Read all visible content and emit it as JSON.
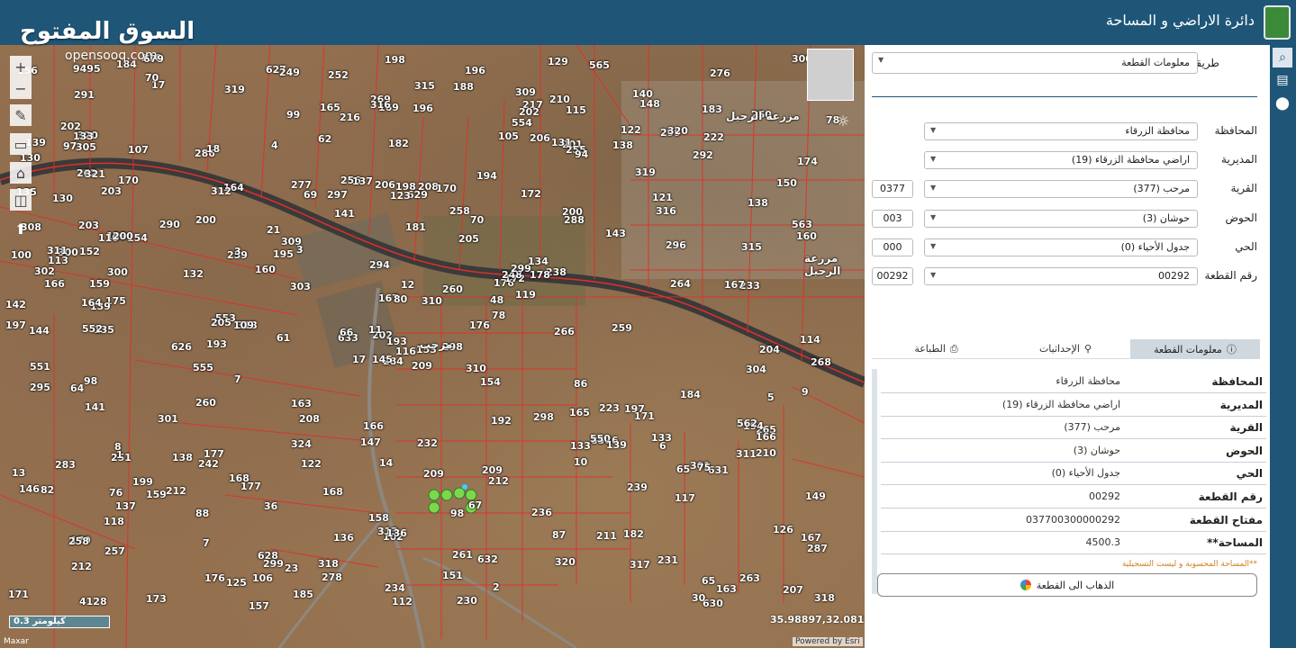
{
  "header": {
    "title": "دائرة الاراضي و المساحة",
    "watermark": "السوق المفتوح",
    "watermark_sub": "opensooq.com"
  },
  "map": {
    "scale_label": "0.3 كيلومتر",
    "coordinates": "35.98897,32.08174",
    "attribution_left": "Maxar",
    "attribution_right": "Powered by Esri",
    "place_labels": [
      "مرحب",
      "مزرعة الرحيل",
      "مزرعة الرحيل"
    ],
    "plot_labels": [
      "209",
      "203",
      "202",
      "179",
      "176",
      "177",
      "210",
      "208",
      "201",
      "176",
      "17",
      "207",
      "175",
      "174",
      "17",
      "200",
      "173",
      "206",
      "205",
      "199",
      "3",
      "212",
      "7",
      "198",
      "172",
      "171",
      "170",
      "169",
      "166",
      "165",
      "160",
      "11",
      "158",
      "167",
      "164",
      "122",
      "168",
      "163",
      "126",
      "197",
      "196",
      "195",
      "132",
      "10",
      "125",
      "100",
      "48",
      "4128",
      "102",
      "78",
      "76",
      "138",
      "139",
      "8586",
      "87",
      "88",
      "70",
      "9495",
      "98",
      "222",
      "315",
      "313",
      "300",
      "200",
      "299",
      "218",
      "217",
      "216",
      "12",
      "13",
      "14",
      "23",
      "223",
      "259",
      "258",
      "291",
      "290",
      "295",
      "294",
      "261",
      "260",
      "257",
      "266",
      "265",
      "234",
      "233",
      "232",
      "231",
      "230",
      "236",
      "269",
      "268",
      "238",
      "239",
      "310",
      "311",
      "113",
      "112",
      "131",
      "255",
      "626",
      "627",
      "114",
      "302",
      "301",
      "242",
      "628",
      "248",
      "292",
      "303",
      "304",
      "305",
      "629",
      "633",
      "249",
      "283",
      "284",
      "250",
      "256",
      "252",
      "251",
      "276",
      "258",
      "277",
      "259",
      "260",
      "263",
      "278",
      "264",
      "262",
      "1",
      "2",
      "3",
      "4",
      "5",
      "6",
      "7",
      "8",
      "9",
      "309",
      "310",
      "300",
      "301",
      "298",
      "299",
      "320",
      "318",
      "317",
      "313",
      "316",
      "315",
      "312",
      "311",
      "185",
      "184",
      "188",
      "182",
      "181",
      "193",
      "194",
      "192",
      "196",
      "197",
      "198",
      "202",
      "203",
      "166",
      "167",
      "679",
      "630",
      "631",
      "632",
      "308",
      "309",
      "134",
      "106",
      "105",
      "133",
      "135",
      "103",
      "130",
      "153",
      "151",
      "152",
      "133",
      "154",
      "110",
      "159",
      "36",
      "193",
      "194",
      "122",
      "123",
      "121",
      "119",
      "136",
      "135",
      "137",
      "133",
      "138",
      "139",
      "140",
      "141",
      "142",
      "143",
      "144",
      "145",
      "146",
      "147",
      "148",
      "149",
      "150",
      "160",
      "166",
      "167",
      "168",
      "159",
      "154",
      "163",
      "164",
      "165",
      "170",
      "171",
      "172",
      "176",
      "177",
      "178",
      "183",
      "184",
      "182",
      "129",
      "130",
      "157",
      "156",
      "555",
      "554",
      "553",
      "552",
      "551",
      "550",
      "563",
      "562",
      "565",
      "200",
      "209",
      "212",
      "287",
      "286",
      "288",
      "296",
      "297",
      "299",
      "300",
      "21",
      "30",
      "319",
      "324",
      "67",
      "70",
      "65",
      "75",
      "86",
      "82",
      "78",
      "80",
      "62",
      "69",
      "18",
      "107",
      "109",
      "99",
      "94",
      "97",
      "98",
      "61",
      "64",
      "65",
      "66",
      "206",
      "204",
      "205",
      "202",
      "298",
      "212",
      "211",
      "208",
      "209",
      "210",
      "136",
      "139",
      "140",
      "141",
      "318",
      "319",
      "316",
      "320",
      "321",
      "320",
      "118",
      "117",
      "116",
      "115",
      "138",
      "137"
    ]
  },
  "search": {
    "method_label": "طريقة البحث",
    "method_value": "معلومات القطعة",
    "fields": [
      {
        "label": "المحافظة",
        "value": "محافظة الزرقاء",
        "code": ""
      },
      {
        "label": "المديرية",
        "value": "اراضي محافظة الزرقاء (19)",
        "code": ""
      },
      {
        "label": "القرية",
        "value": "مرحب (377)",
        "code": "0377"
      },
      {
        "label": "الحوض",
        "value": "حوشان (3)",
        "code": "003"
      },
      {
        "label": "الحي",
        "value": "جدول الأحياء (0)",
        "code": "000"
      },
      {
        "label": "رقم القطعة",
        "value": "00292",
        "code": "00292"
      }
    ]
  },
  "tabs": [
    {
      "label": "معلومات القطعة",
      "icon": "info-icon"
    },
    {
      "label": "الإحداثيات",
      "icon": "person-pin-icon"
    },
    {
      "label": "الطباعة",
      "icon": "print-icon"
    }
  ],
  "info": [
    {
      "key": "المحافظة",
      "value": "محافظة الزرقاء"
    },
    {
      "key": "المديرية",
      "value": "اراضي محافظة الزرقاء (19)"
    },
    {
      "key": "القرية",
      "value": "مرحب (377)"
    },
    {
      "key": "الحوض",
      "value": "حوشان (3)"
    },
    {
      "key": "الحي",
      "value": "جدول الأحياء (0)"
    },
    {
      "key": "رقم القطعة",
      "value": "00292"
    },
    {
      "key": "مفتاح القطعة",
      "value": "037700300000292"
    },
    {
      "key": "المساحة**",
      "value": "4500.3"
    }
  ],
  "note": "**المساحة المحسوبة و ليست التسجيلية",
  "goto_button": "الذهاب الى القطعة",
  "colors": {
    "header": "#1f5678",
    "parcel_lines": "#e0302a",
    "road": "#2b2b2b",
    "note": "#d08020"
  }
}
